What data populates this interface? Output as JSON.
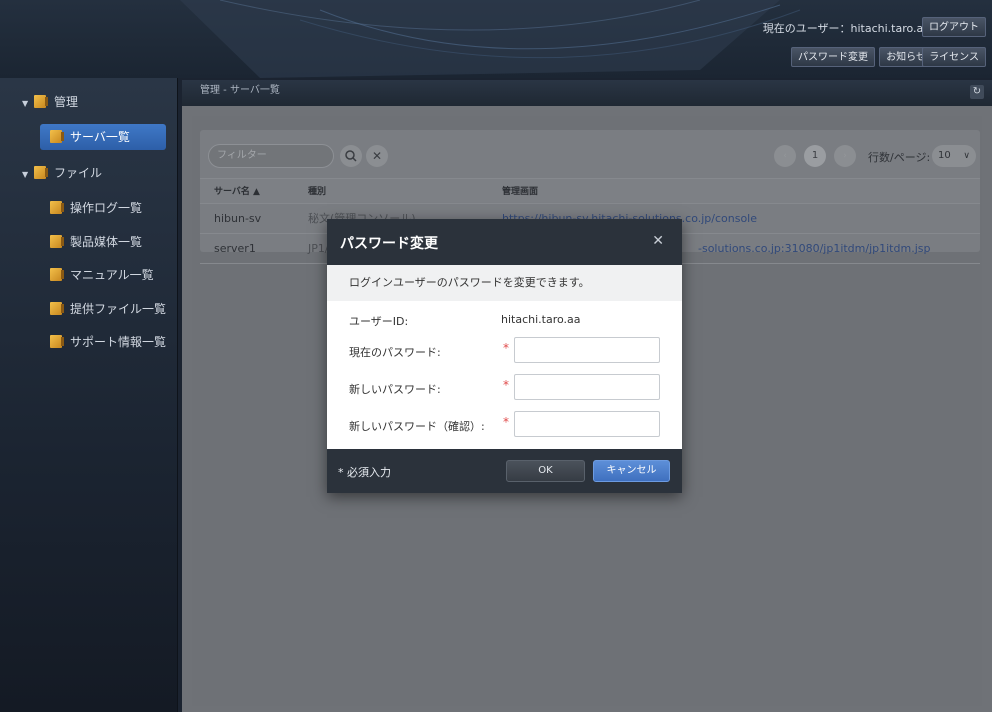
{
  "header": {
    "current_user_label": "現在のユーザー：",
    "current_user": "hitachi.taro.aa",
    "logout": "ログアウト",
    "change_password": "パスワード変更",
    "notices": "お知らせ",
    "license": "ライセンス"
  },
  "sidebar": {
    "items": [
      {
        "label": "管理",
        "type": "group"
      },
      {
        "label": "サーバ一覧",
        "type": "item",
        "selected": true
      },
      {
        "label": "ファイル",
        "type": "group"
      },
      {
        "label": "操作ログ一覧",
        "type": "item"
      },
      {
        "label": "製品媒体一覧",
        "type": "item"
      },
      {
        "label": "マニュアル一覧",
        "type": "item"
      },
      {
        "label": "提供ファイル一覧",
        "type": "item"
      },
      {
        "label": "サポート情報一覧",
        "type": "item"
      }
    ]
  },
  "breadcrumb": "管理 - サーバ一覧",
  "toolbar": {
    "filter_placeholder": "フィルター",
    "current_page": "1",
    "rows_per_page_label": "行数/ページ:",
    "rows_per_page": "10"
  },
  "table": {
    "columns": [
      "サーバ名 ▲",
      "種別",
      "管理画面"
    ],
    "rows": [
      {
        "name": "hibun-sv",
        "type": "秘文(管理コンソール)",
        "url": "https://hibun-sv.hitachi-solutions.co.jp/console"
      },
      {
        "name": "server1",
        "type": "JP1/",
        "url": "-solutions.co.jp:31080/jp1itdm/jp1itdm.jsp"
      }
    ]
  },
  "modal": {
    "title": "パスワード変更",
    "description": "ログインユーザーのパスワードを変更できます。",
    "user_id_label": "ユーザーID:",
    "user_id_value": "hitachi.taro.aa",
    "current_pw_label": "現在のパスワード:",
    "new_pw_label": "新しいパスワード:",
    "confirm_pw_label": "新しいパスワード（確認）:",
    "required_mark": "*",
    "required_note": "* 必須入力",
    "ok": "OK",
    "cancel": "キャンセル"
  },
  "colors": {
    "accent": "#3f78c7",
    "required": "#e04a4a",
    "header_bg": "#2b323b"
  }
}
